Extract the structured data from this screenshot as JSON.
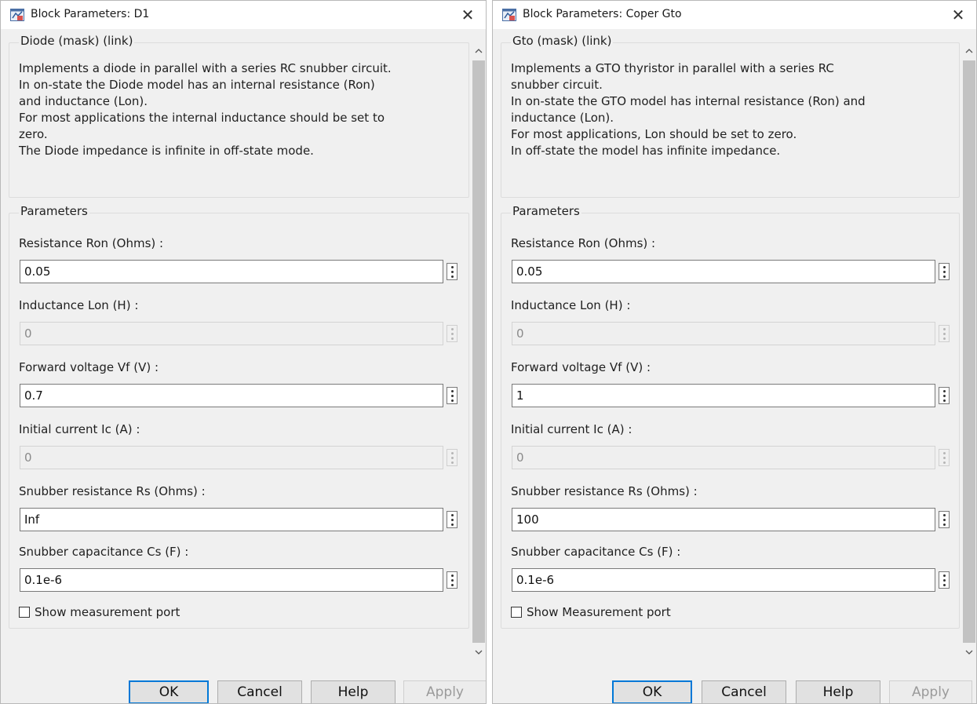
{
  "dialogs": [
    {
      "title": "Block Parameters: D1",
      "close_glyph": "✕",
      "mask_title": "Diode (mask) (link)",
      "description_lines": [
        "Implements a diode in parallel with a series RC snubber circuit.",
        "In on-state the Diode model has an internal resistance (Ron)",
        "and inductance (Lon).",
        "For most applications the internal inductance should be set to",
        "zero.",
        "The Diode impedance is infinite in off-state mode."
      ],
      "params_title": "Parameters",
      "params": [
        {
          "label": "Resistance Ron (Ohms) :",
          "value": "0.05",
          "enabled": true
        },
        {
          "label": "Inductance Lon (H) :",
          "value": "0",
          "enabled": false
        },
        {
          "label": "Forward voltage Vf (V) :",
          "value": "0.7",
          "enabled": true
        },
        {
          "label": "Initial current Ic (A) :",
          "value": "0",
          "enabled": false
        },
        {
          "label": "Snubber resistance Rs (Ohms) :",
          "value": "Inf",
          "enabled": true
        },
        {
          "label": "Snubber capacitance Cs (F) :",
          "value": "0.1e-6",
          "enabled": true
        }
      ],
      "checkbox_label": "Show measurement port",
      "checkbox_checked": false,
      "buttons": {
        "ok": "OK",
        "cancel": "Cancel",
        "help": "Help",
        "apply": "Apply"
      }
    },
    {
      "title": "Block Parameters: Coper Gto",
      "close_glyph": "✕",
      "mask_title": "Gto (mask) (link)",
      "description_lines": [
        "Implements a GTO thyristor in parallel with a series RC",
        "snubber circuit.",
        "In on-state the GTO model has internal resistance (Ron) and",
        "inductance (Lon).",
        "For most applications, Lon should be set to zero.",
        "In off-state the model has infinite impedance."
      ],
      "params_title": "Parameters",
      "params": [
        {
          "label": "Resistance Ron (Ohms) :",
          "value": "0.05",
          "enabled": true
        },
        {
          "label": "Inductance Lon (H) :",
          "value": "0",
          "enabled": false
        },
        {
          "label": "Forward voltage Vf (V) :",
          "value": "1",
          "enabled": true
        },
        {
          "label": "Initial current Ic (A) :",
          "value": "0",
          "enabled": false
        },
        {
          "label": "Snubber resistance Rs (Ohms) :",
          "value": "100",
          "enabled": true
        },
        {
          "label": "Snubber capacitance Cs (F) :",
          "value": "0.1e-6",
          "enabled": true
        }
      ],
      "checkbox_label": "Show Measurement port",
      "checkbox_checked": false,
      "buttons": {
        "ok": "OK",
        "cancel": "Cancel",
        "help": "Help",
        "apply": "Apply"
      }
    }
  ],
  "colors": {
    "dialog_bg": "#f0f0f0",
    "titlebar_bg": "#ffffff",
    "ok_focus_border": "#0078d7",
    "disabled_text": "#8a8a8a",
    "scroll_thumb": "#c2c2c2"
  },
  "icons": {
    "title": "simulink-block-icon",
    "close": "close-icon",
    "param_menu": "kebab-menu-icon",
    "scroll_up": "chevron-up-icon",
    "scroll_down": "chevron-down-icon"
  }
}
